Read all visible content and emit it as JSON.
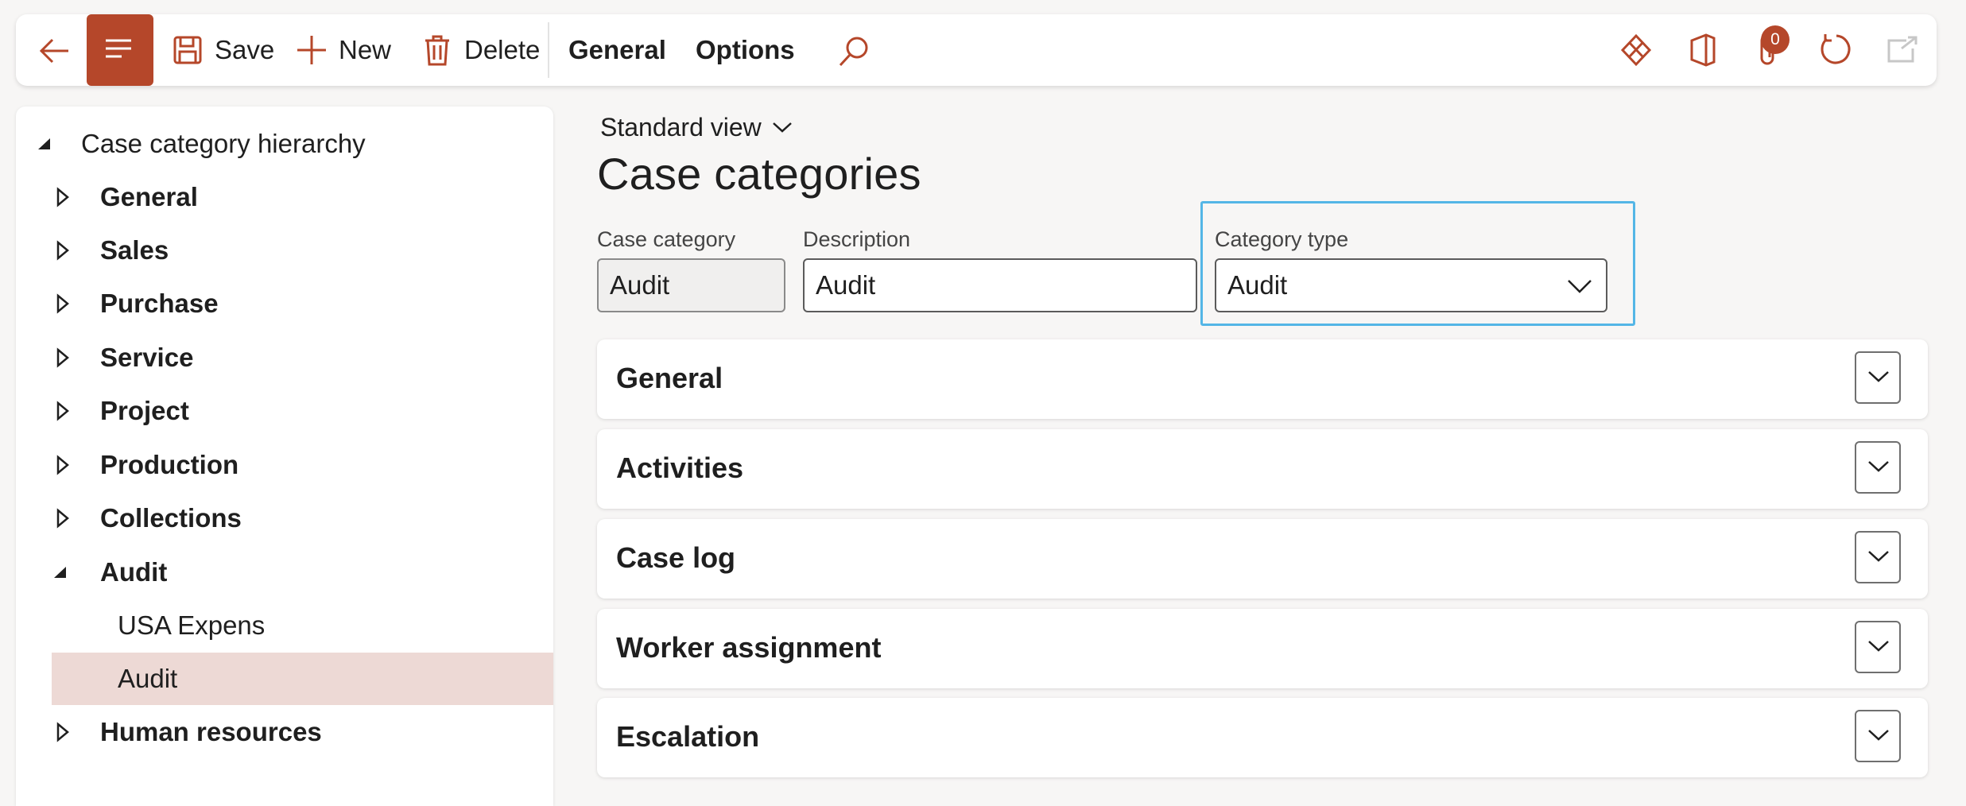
{
  "toolbar": {
    "save_label": "Save",
    "new_label": "New",
    "delete_label": "Delete",
    "tabs": [
      "General",
      "Options"
    ],
    "attachments_count": "0",
    "accent_color": "#b5472a"
  },
  "tree": {
    "root": "Case category hierarchy",
    "items": [
      {
        "label": "General",
        "expanded": false
      },
      {
        "label": "Sales",
        "expanded": false
      },
      {
        "label": "Purchase",
        "expanded": false
      },
      {
        "label": "Service",
        "expanded": false
      },
      {
        "label": "Project",
        "expanded": false
      },
      {
        "label": "Production",
        "expanded": false
      },
      {
        "label": "Collections",
        "expanded": false
      },
      {
        "label": "Audit",
        "expanded": true
      },
      {
        "label": "Human resources",
        "expanded": false
      }
    ],
    "audit_children": [
      "USA Expens",
      "Audit"
    ],
    "selected": "Audit"
  },
  "main": {
    "view": "Standard view",
    "title": "Case categories",
    "fields": {
      "case_category_label": "Case category",
      "case_category_value": "Audit",
      "description_label": "Description",
      "description_value": "Audit",
      "category_type_label": "Category type",
      "category_type_value": "Audit"
    },
    "fasttabs": [
      "General",
      "Activities",
      "Case log",
      "Worker assignment",
      "Escalation"
    ]
  }
}
